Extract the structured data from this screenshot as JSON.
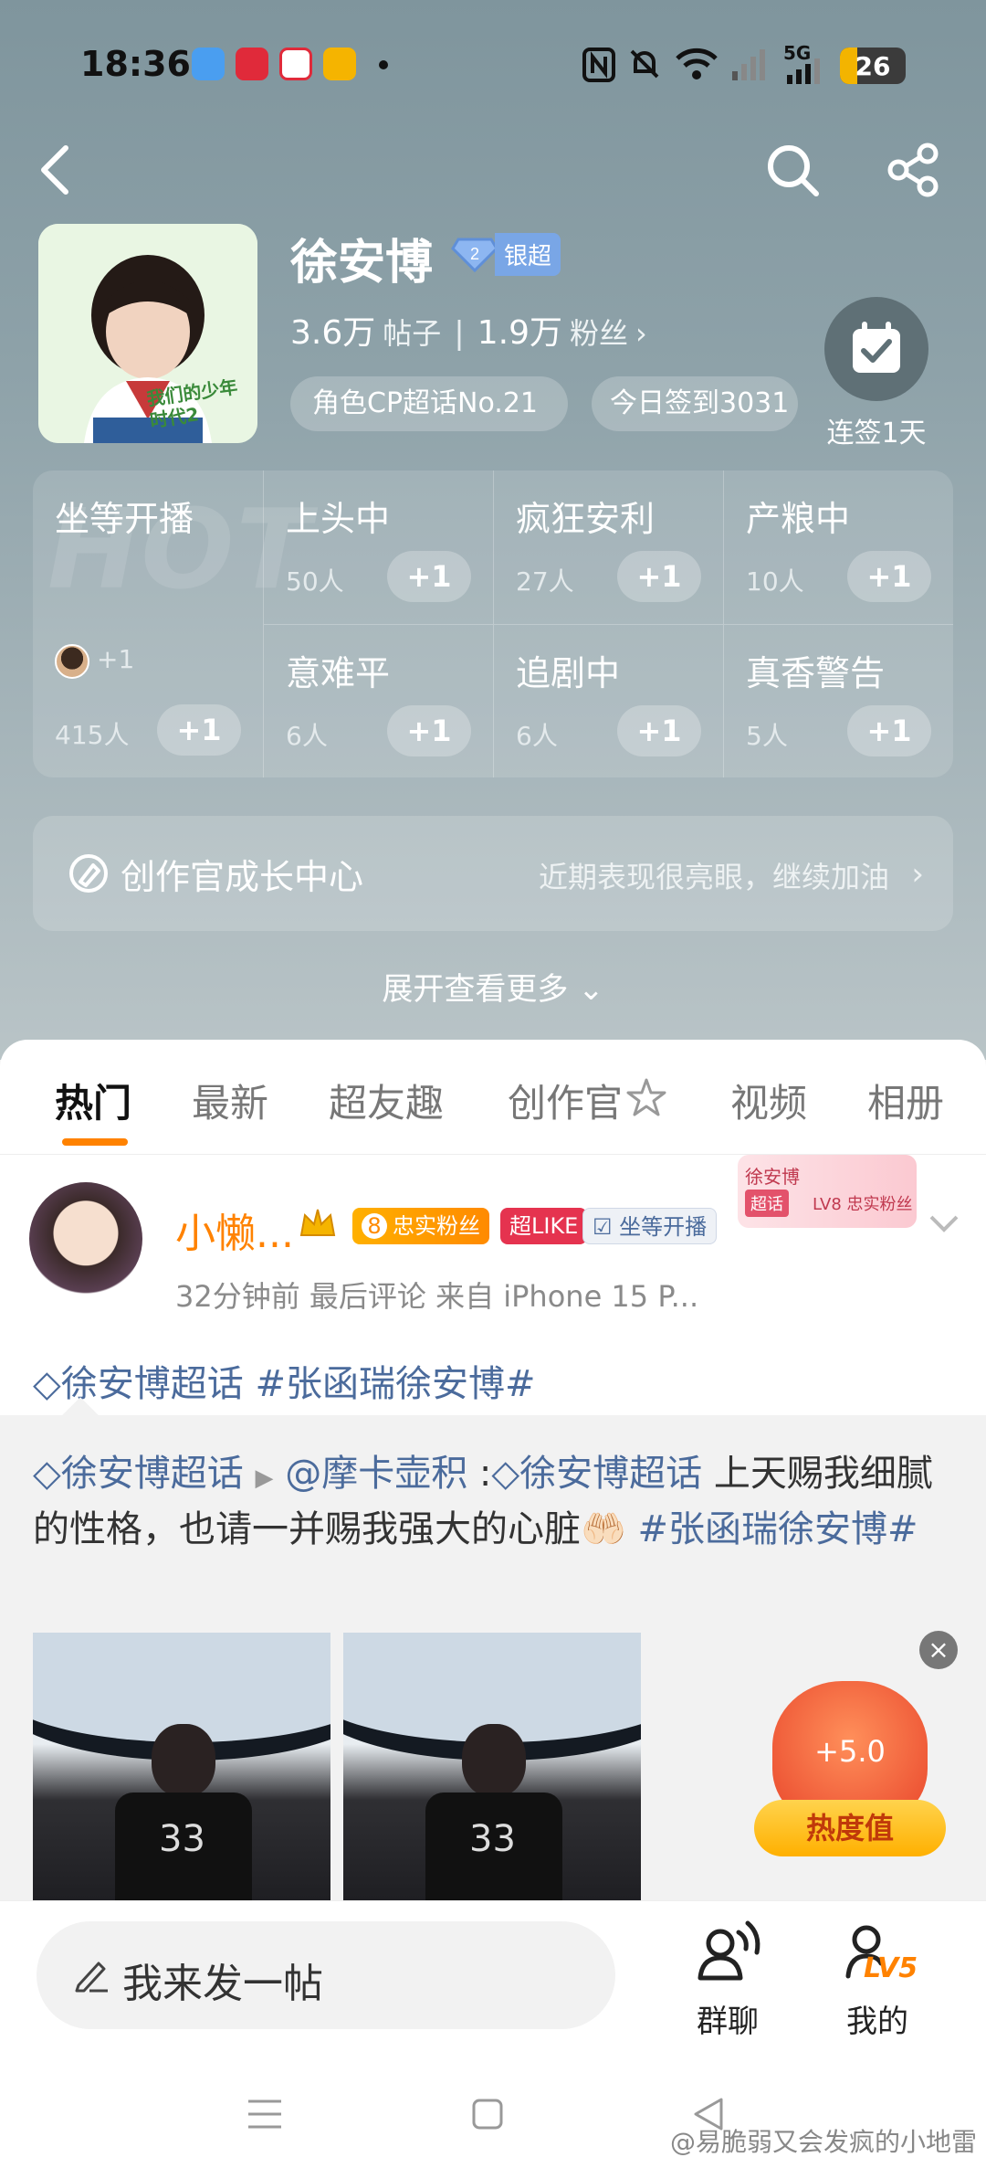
{
  "status_bar": {
    "time": "18:36",
    "network": "5G",
    "battery": "26",
    "battery_level": 0.26
  },
  "topic": {
    "name": "徐安博",
    "rank_level": "2",
    "rank_label": "银超",
    "posts_num": "3.6万",
    "posts_label": "帖子",
    "fans_num": "1.9万",
    "fans_label": "粉丝",
    "pill_rank": "角色CP超话No.21",
    "pill_checkin": "今日签到3031",
    "checkin_label": "连签1天",
    "avatar_text": "我们的少年时代2"
  },
  "moods": {
    "hot_watermark": "HOT",
    "main": {
      "title": "坐等开播",
      "count": "415人",
      "plus": "+1",
      "mini_plus": "+1"
    },
    "items": [
      {
        "title": "上头中",
        "count": "50人",
        "plus": "+1"
      },
      {
        "title": "疯狂安利",
        "count": "27人",
        "plus": "+1"
      },
      {
        "title": "产粮中",
        "count": "10人",
        "plus": "+1"
      },
      {
        "title": "意难平",
        "count": "6人",
        "plus": "+1"
      },
      {
        "title": "追剧中",
        "count": "6人",
        "plus": "+1"
      },
      {
        "title": "真香警告",
        "count": "5人",
        "plus": "+1"
      }
    ]
  },
  "growth": {
    "title": "创作官成长中心",
    "subtitle": "近期表现很亮眼，继续加油"
  },
  "expand_label": "展开查看更多",
  "tabs": [
    "热门",
    "最新",
    "超友趣",
    "创作官",
    "视频",
    "相册"
  ],
  "post": {
    "username": "小懒...",
    "badge_fan_level": "8",
    "badge_fan": "忠实粉丝",
    "badge_like": "超LIKE",
    "badge_status": "坐等开播",
    "fan_card": {
      "name": "徐安博",
      "tag": "超话",
      "level": "LV8 忠实粉丝"
    },
    "meta": "32分钟前 最后评论    来自 iPhone 15 P...",
    "tags": "徐安博超话  #张函瑞徐安博#"
  },
  "quote": {
    "prefix_tag": "徐安博超话",
    "mention": "@摩卡壶积",
    "inner_tag": "徐安博超话",
    "body": " 上天赐我细腻的性格，也请一并赐我强大的心脏🤲🏻 ",
    "hashtag": "#张函瑞徐安博#",
    "photo_text": "33"
  },
  "reward": {
    "value": "+5.0",
    "button": "热度值"
  },
  "bottom": {
    "composer_placeholder": "我来发一帖",
    "group_chat": "群聊",
    "mine": "我的",
    "mine_level": "LV5"
  },
  "watermark": "@易脆弱又会发疯的小地雷",
  "colors": {
    "accent": "#ff8200",
    "link": "#4b6b9c",
    "hero_bg": "#8ea2a9"
  }
}
